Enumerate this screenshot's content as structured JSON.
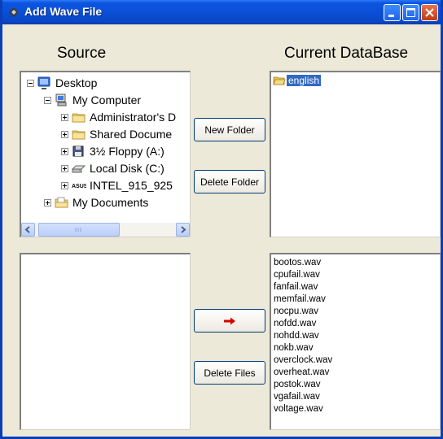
{
  "window": {
    "title": "Add Wave File"
  },
  "headings": {
    "source": "Source",
    "database": "Current DataBase"
  },
  "tree": [
    {
      "label": "Desktop",
      "indent": 0,
      "expander": "minus",
      "icon": "desktop-icon"
    },
    {
      "label": "My Computer",
      "indent": 1,
      "expander": "minus",
      "icon": "computer-icon"
    },
    {
      "label": "Administrator's D",
      "indent": 2,
      "expander": "plus",
      "icon": "folder-icon"
    },
    {
      "label": "Shared Docume",
      "indent": 2,
      "expander": "plus",
      "icon": "folder-icon"
    },
    {
      "label": "3½ Floppy (A:)",
      "indent": 2,
      "expander": "plus",
      "icon": "floppy-icon"
    },
    {
      "label": "Local Disk (C:)",
      "indent": 2,
      "expander": "plus",
      "icon": "disk-icon"
    },
    {
      "label": "INTEL_915_925",
      "indent": 2,
      "expander": "plus",
      "icon": "asus-drive-icon",
      "badge": "ASUS"
    },
    {
      "label": "My Documents",
      "indent": 1,
      "expander": "plus",
      "icon": "documents-icon"
    }
  ],
  "buttons": {
    "new_folder": "New Folder",
    "delete_folder": "Delete Folder",
    "add_arrow": "",
    "delete_files": "Delete Files"
  },
  "database": {
    "items": [
      "english"
    ]
  },
  "files": [
    "bootos.wav",
    "cpufail.wav",
    "fanfail.wav",
    "memfail.wav",
    "nocpu.wav",
    "nofdd.wav",
    "nohdd.wav",
    "nokb.wav",
    "overclock.wav",
    "overheat.wav",
    "postok.wav",
    "vgafail.wav",
    "voltage.wav"
  ],
  "source_files": [],
  "colors": {
    "titlebar": "#0a4fd6",
    "selection": "#316ac5",
    "arrow": "#d40000"
  }
}
